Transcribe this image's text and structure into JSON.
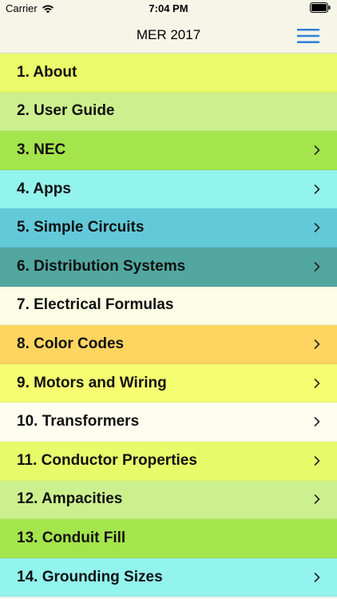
{
  "status_bar": {
    "carrier": "Carrier",
    "time": "7:04 PM"
  },
  "nav": {
    "title": "MER 2017",
    "menu_icon": "hamburger-menu-icon",
    "accent_color": "#2f7fd6"
  },
  "menu": {
    "items": [
      {
        "label": "1. About",
        "color": "#e9fb6a",
        "has_chevron": false
      },
      {
        "label": "2. User Guide",
        "color": "#cdf08e",
        "has_chevron": false
      },
      {
        "label": "3. NEC",
        "color": "#a4e44d",
        "has_chevron": true
      },
      {
        "label": "4. Apps",
        "color": "#93f3ed",
        "has_chevron": true
      },
      {
        "label": "5. Simple Circuits",
        "color": "#62c9d9",
        "has_chevron": true
      },
      {
        "label": "6. Distribution Systems",
        "color": "#52a7a0",
        "has_chevron": true
      },
      {
        "label": "7. Electrical Formulas",
        "color": "#fcfde4",
        "has_chevron": false
      },
      {
        "label": "8. Color Codes",
        "color": "#fed561",
        "has_chevron": true
      },
      {
        "label": "9. Motors and Wiring",
        "color": "#f5fe70",
        "has_chevron": true
      },
      {
        "label": "10. Transformers",
        "color": "#fdfdf0",
        "has_chevron": true
      },
      {
        "label": "11. Conductor Properties",
        "color": "#e7fb6a",
        "has_chevron": true
      },
      {
        "label": "12. Ampacities",
        "color": "#cdf08e",
        "has_chevron": true
      },
      {
        "label": "13. Conduit Fill",
        "color": "#a4e44d",
        "has_chevron": false
      },
      {
        "label": "14. Grounding Sizes",
        "color": "#93f3ed",
        "has_chevron": true
      }
    ]
  }
}
